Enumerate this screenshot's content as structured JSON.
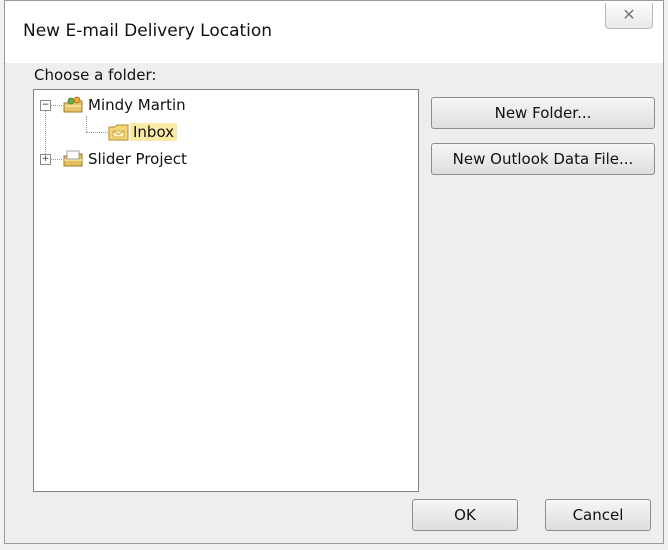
{
  "dialog": {
    "title": "New E-mail Delivery Location",
    "close_glyph": "✕"
  },
  "folder_picker": {
    "label": "Choose a folder:",
    "tree": [
      {
        "label": "Mindy Martin",
        "expanded": true,
        "icon": "account-folder-icon",
        "children": [
          {
            "label": "Inbox",
            "icon": "inbox-folder-icon",
            "selected": true
          }
        ]
      },
      {
        "label": "Slider Project",
        "expanded": false,
        "icon": "data-file-icon"
      }
    ]
  },
  "buttons": {
    "new_folder": "New Folder...",
    "new_data_file": "New Outlook Data File...",
    "ok": "OK",
    "cancel": "Cancel"
  }
}
